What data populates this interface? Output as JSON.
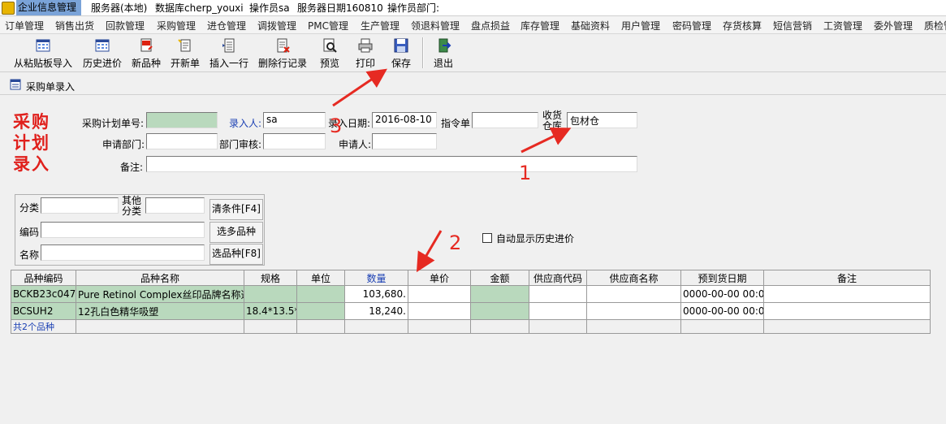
{
  "titlebar": {
    "app": "企业信息管理",
    "server": "服务器(本地)",
    "database": "数据库cherp_youxi",
    "operator": "操作员sa",
    "server_date": "服务器日期160810",
    "dept": "操作员部门:"
  },
  "menu": [
    "订单管理",
    "销售出货",
    "回款管理",
    "采购管理",
    "进仓管理",
    "调拨管理",
    "PMC管理",
    "生产管理",
    "领退料管理",
    "盘点损益",
    "库存管理",
    "基础资料",
    "用户管理",
    "密码管理",
    "存货核算",
    "短信营销",
    "工资管理",
    "委外管理",
    "质检管理"
  ],
  "toolbar": {
    "import": "从粘贴板导入",
    "history": "历史进价",
    "new_item": "新品种",
    "new_doc": "开新单",
    "insert_row": "插入一行",
    "delete_row": "删除行记录",
    "preview": "预览",
    "print": "打印",
    "save": "保存",
    "exit": "退出"
  },
  "window": {
    "title": "采购单录入"
  },
  "form": {
    "heading": "采购计划录入",
    "plan_no_label": "采购计划单号:",
    "plan_no": "",
    "entered_by_label": "录入人:",
    "entered_by": "sa",
    "entry_date_label": "录入日期:",
    "entry_date": "2016-08-10",
    "order_label": "指令单",
    "order": "",
    "warehouse_label": "收货仓库",
    "warehouse": "包材仓",
    "dept_label": "申请部门:",
    "dept": "",
    "dept_audit_label": "部门审核:",
    "dept_audit": "",
    "applicant_label": "申请人:",
    "applicant": "",
    "remark_label": "备注:",
    "remark": ""
  },
  "filter": {
    "category_label": "分类",
    "other_label": "其他分类",
    "code_label": "编码",
    "name_label": "名称",
    "clear": "清条件[F4]",
    "multi": "选多品种",
    "select": "选品种[F8]"
  },
  "auto_history": {
    "label": "自动显示历史进价",
    "checked": false
  },
  "table": {
    "columns": [
      "品种编码",
      "品种名称",
      "规格",
      "单位",
      "数量",
      "单价",
      "金额",
      "供应商代码",
      "供应商名称",
      "预到货日期",
      "备注"
    ],
    "rows": [
      [
        "BCKB23c047",
        "Pure Retinol Complex丝印品牌名称透",
        "",
        "",
        "103,680.",
        "",
        "",
        "",
        "",
        "0000-00-00 00:00",
        ""
      ],
      [
        "BCSUH2",
        "12孔白色精华吸塑",
        "18.4*13.5*1",
        "",
        "18,240.",
        "",
        "",
        "",
        "",
        "0000-00-00 00:00",
        ""
      ]
    ],
    "summary": "共2个品种"
  },
  "annotations": {
    "one": "1",
    "two": "2",
    "three": "3"
  },
  "colors": {
    "accent_red": "#e62a22",
    "cell_green": "#b9d9bd",
    "blue_label": "#1a3fb3"
  }
}
